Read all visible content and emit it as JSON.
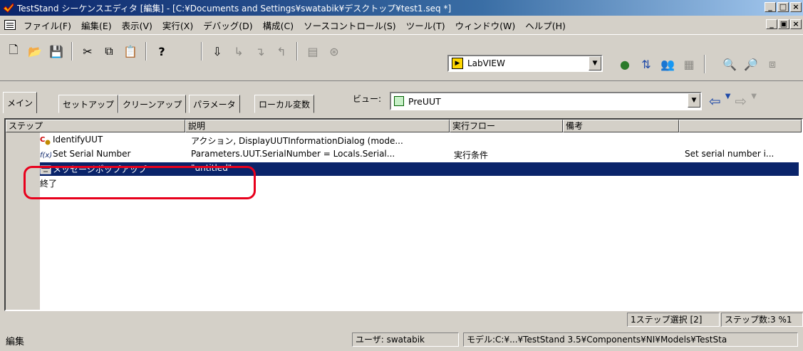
{
  "window": {
    "title": "TestStand シーケンスエディタ [編集] - [C:¥Documents and Settings¥swatabik¥デスクトップ¥test1.seq *]",
    "controls": [
      "minimize",
      "maximize",
      "close"
    ]
  },
  "menu": {
    "items": [
      "ファイル(F)",
      "編集(E)",
      "表示(V)",
      "実行(X)",
      "デバッグ(D)",
      "構成(C)",
      "ソースコントロール(S)",
      "ツール(T)",
      "ウィンドウ(W)",
      "ヘルプ(H)"
    ]
  },
  "toolbar": {
    "adapter": "LabVIEW"
  },
  "tabs": [
    "メイン",
    "セットアップ",
    "クリーンアップ",
    "パラメータ",
    "ローカル変数"
  ],
  "view": {
    "label": "ビュー:",
    "selected": "PreUUT"
  },
  "grid": {
    "columns": [
      "ステップ",
      "説明",
      "実行フロー",
      "備考",
      ""
    ],
    "rows": [
      {
        "step": "IdentifyUUT",
        "description": "アクション, DisplayUUTInformationDialog (mode...",
        "flow": "",
        "comment": "",
        "extra": ""
      },
      {
        "step": "Set Serial Number",
        "description": "Parameters.UUT.SerialNumber = Locals.Serial...",
        "flow": "実行条件",
        "comment": "",
        "extra": "Set serial number i..."
      },
      {
        "step": "メッセージポップアップ",
        "description": "\"untitled\"",
        "flow": "",
        "comment": "",
        "extra": ""
      },
      {
        "step": "終了",
        "description": "",
        "flow": "",
        "comment": "",
        "extra": ""
      }
    ],
    "selected_row": 2
  },
  "status": {
    "selection": "1ステップ選択 [2]",
    "count": "ステップ数:3 %1",
    "mode": "編集",
    "user": "ユーザ: swatabik",
    "model": "モデル:C:¥...¥TestStand 3.5¥Components¥NI¥Models¥TestSta"
  },
  "colors": {
    "title_active": "#0a246a",
    "selection": "#0a246a",
    "face": "#d4d0c8",
    "annotation": "#e8001c"
  }
}
